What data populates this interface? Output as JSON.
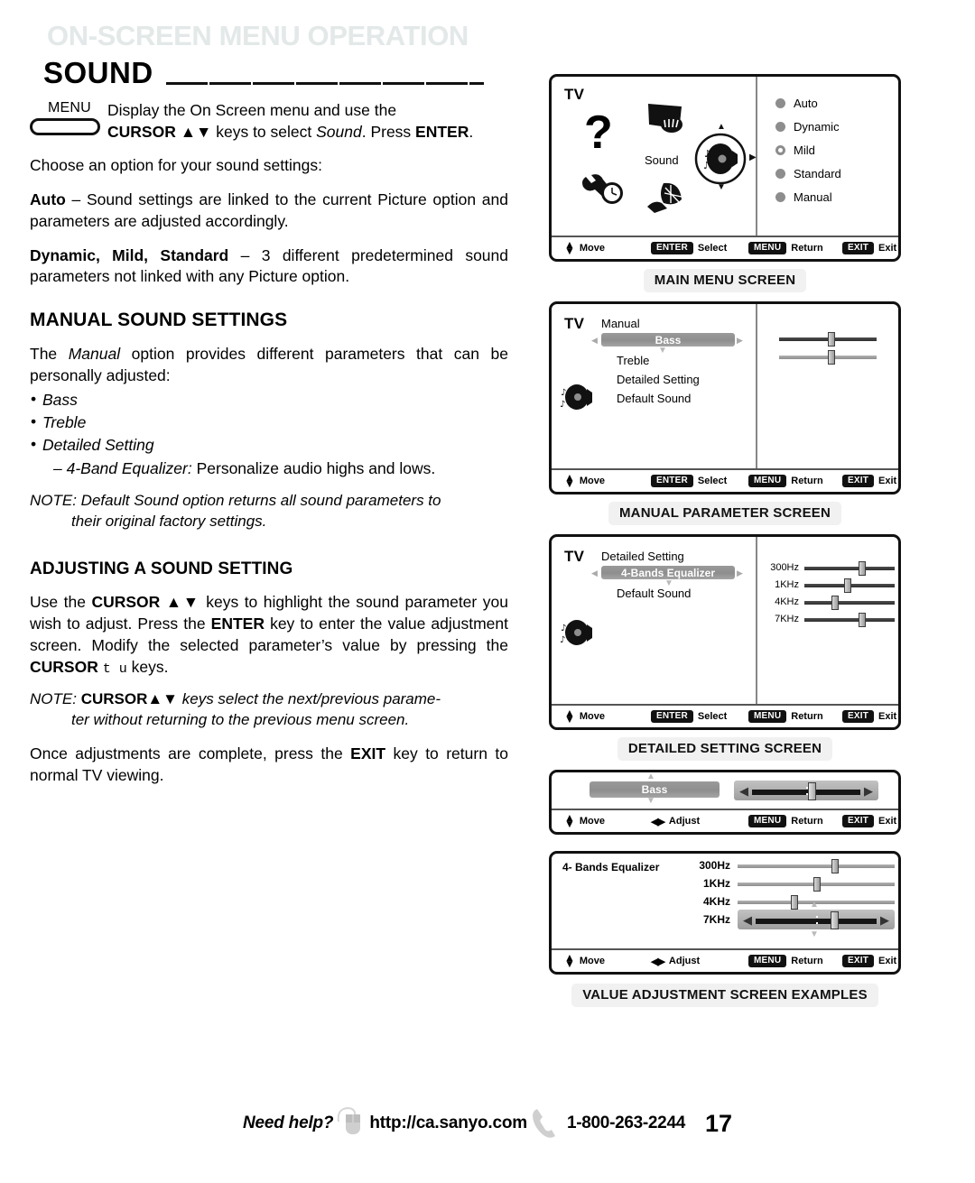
{
  "header": {
    "section_title": "ON-SCREEN MENU OPERATION",
    "page_title": "SOUND"
  },
  "left": {
    "menu_key_label": "MENU",
    "menu_instruction_line1": "Display the On Screen menu and use the",
    "menu_instruction_line2_a": "CURSOR ",
    "menu_instruction_line2_arrows": "▲▼",
    "menu_instruction_line2_b": " keys to select ",
    "menu_instruction_line2_italic": "Sound",
    "menu_instruction_line2_c": ". Press ",
    "menu_instruction_line2_bold": "ENTER",
    "menu_instruction_line2_d": ".",
    "choose_line": "Choose an option for your sound settings:",
    "auto_bold": "Auto",
    "auto_text": " – Sound settings are linked to the current Picture option and parameters are adjusted accordingly.",
    "dynamic_bold": "Dynamic, Mild, Standard",
    "dynamic_text": " – 3 different predetermined sound parameters not linked with any Picture option.",
    "manual_heading": "MANUAL SOUND SETTINGS",
    "manual_intro_a": "The ",
    "manual_intro_italic": "Manual",
    "manual_intro_b": " option provides different parameters that can be personally adjusted:",
    "bullets": [
      "Bass",
      "Treble",
      "Detailed Setting"
    ],
    "subbullet_italic": "– 4-Band Equalizer:",
    "subbullet_rest": " Personalize audio highs and lows.",
    "note1_line1": "NOTE: Default Sound option returns all sound parameters to",
    "note1_line2": "their original factory settings.",
    "adjust_heading": "ADJUSTING A SOUND SETTING",
    "adjust_p1_a": "Use the ",
    "adjust_p1_cursor": "CURSOR",
    "adjust_p1_arrows": "▲▼",
    "adjust_p1_b": " keys to highlight the sound parameter you wish to adjust. Press the ",
    "adjust_p1_enter": "ENTER",
    "adjust_p1_c": " key to enter the value adjustment screen. Modify the selected parameter’s value by pressing the ",
    "adjust_p1_cursor2": "CURSOR",
    "adjust_p1_mono": "t u",
    "adjust_p1_d": " keys.",
    "note2_label": "NOTE:",
    "note2_cursor": "CURSOR",
    "note2_arrows": "▲▼",
    "note2_line1": " keys select the next/previous parame-",
    "note2_line2": "ter without returning to the previous menu screen.",
    "final_a": "Once adjustments are complete, press the ",
    "final_exit": "EXIT",
    "final_b": " key to return to normal TV viewing."
  },
  "screens": {
    "main_menu": {
      "tv_label": "TV",
      "center_label": "Sound",
      "icons": [
        "question-mark-icon",
        "picture-icon",
        "speaker-dial-icon",
        "setup-clock-wrench-icon",
        "antenna-icon"
      ],
      "options": [
        {
          "label": "Auto",
          "selected": false
        },
        {
          "label": "Dynamic",
          "selected": false
        },
        {
          "label": "Mild",
          "selected": true
        },
        {
          "label": "Standard",
          "selected": false
        },
        {
          "label": "Manual",
          "selected": false
        }
      ],
      "caption": "MAIN MENU SCREEN"
    },
    "manual_parameter": {
      "tv_label": "TV",
      "menu_title": "Manual",
      "items": [
        {
          "label": "Bass",
          "highlighted": true
        },
        {
          "label": "Treble",
          "highlighted": false
        },
        {
          "label": "Detailed Setting",
          "highlighted": false
        },
        {
          "label": "Default Sound",
          "highlighted": false
        }
      ],
      "sliders": [
        {
          "name": "bass",
          "position_pct": 50
        },
        {
          "name": "treble",
          "position_pct": 50
        }
      ],
      "caption": "MANUAL PARAMETER SCREEN"
    },
    "detailed_setting": {
      "tv_label": "TV",
      "menu_title": "Detailed Setting",
      "items": [
        {
          "label": "4-Bands Equalizer",
          "highlighted": true
        },
        {
          "label": "Default Sound",
          "highlighted": false
        }
      ],
      "bands": [
        {
          "label": "300Hz",
          "position_pct": 60
        },
        {
          "label": "1KHz",
          "position_pct": 44
        },
        {
          "label": "4KHz",
          "position_pct": 30
        },
        {
          "label": "7KHz",
          "position_pct": 60
        }
      ],
      "caption": "DETAILED SETTING SCREEN"
    },
    "value_bass": {
      "title": "Bass",
      "slider_position_pct": 52
    },
    "value_equalizer": {
      "title": "4- Bands Equalizer",
      "bands": [
        {
          "label": "300Hz",
          "position_pct": 60,
          "active": false
        },
        {
          "label": "1KHz",
          "position_pct": 48,
          "active": false
        },
        {
          "label": "4KHz",
          "position_pct": 34,
          "active": false
        },
        {
          "label": "7KHz",
          "position_pct": 62,
          "active": true
        }
      ],
      "caption": "VALUE ADJUSTMENT SCREEN EXAMPLES"
    }
  },
  "footbar": {
    "move": "Move",
    "adjust": "Adjust",
    "enter_key": "ENTER",
    "select": "Select",
    "menu_key": "MENU",
    "return": "Return",
    "exit_key": "EXIT",
    "exit": "Exit"
  },
  "footer": {
    "need_help": "Need help?",
    "url": "http://ca.sanyo.com",
    "phone": "1-800-263-2244",
    "page_number": "17"
  },
  "colors": {
    "section_title": "#e3e8e8",
    "highlight_bar": "#939393",
    "caption_bg": "#f1f1f1",
    "keycap_bg": "#111111"
  }
}
